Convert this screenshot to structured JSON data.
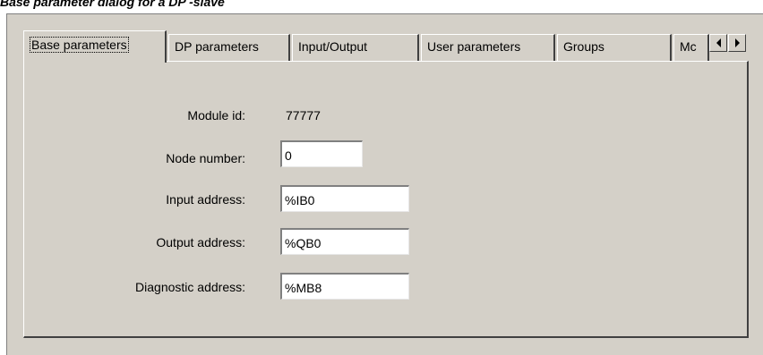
{
  "caption": "Base parameter dialog for a DP -slave",
  "tabs": [
    {
      "label": "Base parameters",
      "active": true
    },
    {
      "label": "DP parameters",
      "active": false
    },
    {
      "label": "Input/Output",
      "active": false
    },
    {
      "label": "User parameters",
      "active": false
    },
    {
      "label": "Groups",
      "active": false
    },
    {
      "label": "Mc",
      "active": false
    }
  ],
  "form": {
    "module_id_label": "Module id:",
    "module_id_value": "77777",
    "node_number_label": "Node number:",
    "node_number_value": "0",
    "input_address_label": "Input address:",
    "input_address_value": "%IB0",
    "output_address_label": "Output address:",
    "output_address_value": "%QB0",
    "diagnostic_address_label": "Diagnostic address:",
    "diagnostic_address_value": "%MB8"
  },
  "icons": {
    "scroll_left": "triangle-left",
    "scroll_right": "triangle-right"
  }
}
